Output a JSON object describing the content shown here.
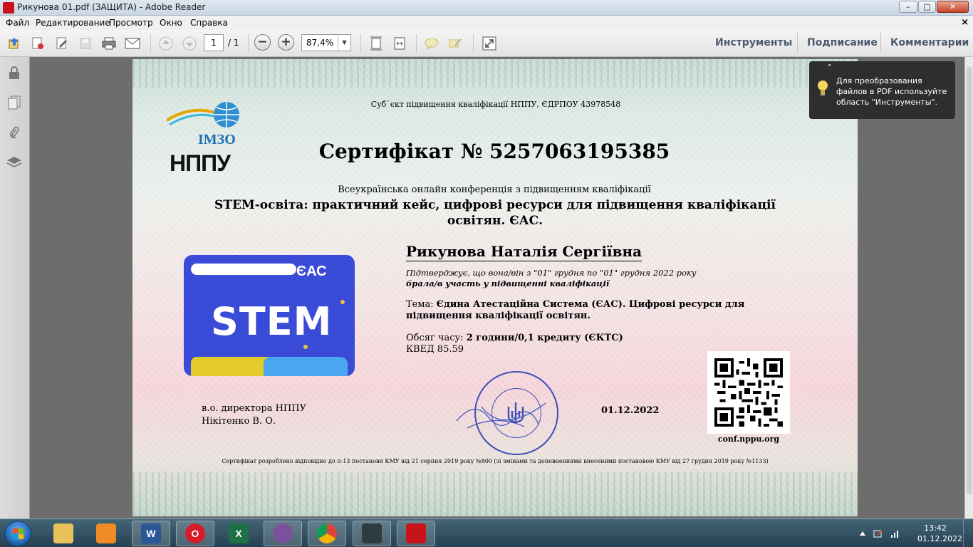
{
  "window": {
    "title": "Рикунова 01.pdf (ЗАЩИТА) - Adobe Reader",
    "minimize": "–",
    "maximize": "□",
    "close": "✕"
  },
  "menu": {
    "items": [
      "Файл",
      "Редактирование",
      "Просмотр",
      "Окно",
      "Справка"
    ],
    "close_doc": "×"
  },
  "toolbar": {
    "page_current": "1",
    "page_total": "/ 1",
    "zoom_out": "−",
    "zoom_in": "+",
    "zoom_value": "87,4%",
    "zoom_dropdown": "▼",
    "tools": "Инструменты",
    "sign": "Подписание",
    "comment": "Комментарии"
  },
  "tooltip": {
    "caret": "⌃",
    "text": "Для преобразования файлов в PDF используйте область \"Инструменты\"."
  },
  "certificate": {
    "subject": "Суб`єкт підвищення кваліфікації НППУ, ЄДРПОУ 43978548",
    "logo_imzo": "ІМЗО",
    "logo_nppu": "НППУ",
    "title": "Сертифікат № 5257063195385",
    "conference_type": "Всеукраїнська онлайн конференція з підвищенням кваліфікації",
    "conference_name": "STEM-освіта: практичний кейс, цифрові ресурси для підвищення кваліфікації освітян. ЄАС.",
    "stem_card": {
      "eas": "ЄАС",
      "stem": "STEM"
    },
    "person": "Рикунова Наталія Сергіївна",
    "confirm_line1": "Підтверджує, що вона/він з \"01\" грудня по \"01\" грудня 2022 року",
    "confirm_line2": "брала/в участь у підвищенні кваліфікації",
    "topic_label": "Тема:",
    "topic_value": "Єдина Атестаційна Система (ЄАС). Цифрові ресурси для підвищення кваліфікації освітян.",
    "hours_label": "Обсяг часу:",
    "hours_value": "2 години/0,1 кредиту (ЄКТС)",
    "kved": "КВЕД 85.59",
    "director_line1": "в.о. директора НППУ",
    "director_line2": "Нікітенко В. О.",
    "date": "01.12.2022",
    "qr_link": "conf.nppu.org",
    "footnote": "Сертифікат розроблено відповідно до п-13 постанови КМУ від 21 серпня 2019 року №800 (зі змінами та доповненнями внесеними постановою КМУ від 27 грудня 2019 року №1133)"
  },
  "taskbar": {
    "apps": [
      {
        "name": "explorer",
        "label": ""
      },
      {
        "name": "media-player",
        "label": ""
      },
      {
        "name": "word",
        "label": "W"
      },
      {
        "name": "opera",
        "label": "O"
      },
      {
        "name": "excel",
        "label": "X"
      },
      {
        "name": "viber",
        "label": ""
      },
      {
        "name": "chrome",
        "label": ""
      },
      {
        "name": "app",
        "label": ""
      },
      {
        "name": "adobe-reader",
        "label": ""
      }
    ],
    "time": "13:42",
    "date": "01.12.2022"
  },
  "colors": {
    "accent_blue": "#3a4bd8",
    "stamp_blue": "#3d4fb8",
    "reader_red": "#c8131b"
  }
}
